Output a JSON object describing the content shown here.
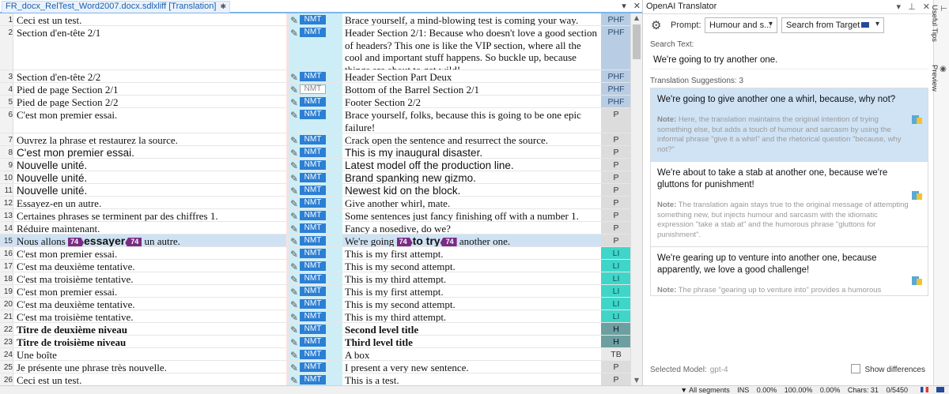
{
  "editor": {
    "tab_title": "FR_docx_RelTest_Word2007.docx.sdlxliff [Translation]",
    "pin": "✱",
    "controls": {
      "dropdown": "▾",
      "close": "✕"
    },
    "status_badge": "NMT",
    "rows": [
      {
        "n": "1",
        "src": "Ceci est un test.",
        "tgt": "Brace yourself, a mind-blowing test is coming your way.",
        "ctx": "PHF"
      },
      {
        "n": "2",
        "src": "Section d'en-tête 2/1",
        "tgt": "Header Section 2/1: Because who doesn't love a good section of headers? This one is like the VIP section, where all the cool and important stuff happens. So buckle up, because things are about to get wild!",
        "ctx": "PHF"
      },
      {
        "n": "3",
        "src": "Section d'en-tête 2/2",
        "tgt_a": "Header Section Part ",
        "tgt_b": "Deux",
        "ctx": "PHF"
      },
      {
        "n": "4",
        "src": "Pied de page Section 2/1",
        "tgt": "Bottom of the Barrel Section 2/1",
        "ctx": "PHF"
      },
      {
        "n": "5",
        "src": "Pied de page Section 2/2",
        "tgt": "Footer Section 2/2",
        "ctx": "PHF"
      },
      {
        "n": "6",
        "src": "C'est mon premier essai.",
        "tgt": "Brace yourself, folks, because this is going to be one epic failure!",
        "ctx": "P"
      },
      {
        "n": "7",
        "src": "Ouvrez la phrase et restaurez la source.",
        "tgt": "Crack open the sentence and resurrect the source.",
        "ctx": "P"
      },
      {
        "n": "8",
        "src": "C'est mon premier essai.",
        "tgt": "This is my inaugural disaster.",
        "ctx": "P"
      },
      {
        "n": "9",
        "src": "Nouvelle unité.",
        "tgt": "Latest model off the production line.",
        "ctx": "P"
      },
      {
        "n": "10",
        "src": "Nouvelle unité.",
        "tgt_a": "Brand spanking new ",
        "tgt_b": "gizmo",
        "tgt_c": ".",
        "ctx": "P"
      },
      {
        "n": "11",
        "src": "Nouvelle unité.",
        "tgt": "Newest kid on the block.",
        "ctx": "P"
      },
      {
        "n": "12",
        "src": "Essayez-en un autre.",
        "tgt": "Give another whirl, mate.",
        "ctx": "P"
      },
      {
        "n": "13",
        "src": "Certaines phrases se terminent par des chiffres 1.",
        "tgt": "Some sentences just fancy finishing off with a number 1.",
        "ctx": "P"
      },
      {
        "n": "14",
        "src": "Réduire maintenant.",
        "tgt": "Fancy a nosedive, do we?",
        "ctx": "P"
      },
      {
        "n": "15",
        "src_a": "Nous allons ",
        "src_b": "essayer",
        "src_c": " un autre.",
        "tag": "74",
        "tgt_a": "We're going ",
        "tgt_b": "to try",
        "tgt_c": " another one.",
        "ctx": "P"
      },
      {
        "n": "16",
        "src": "C'est mon premier essai.",
        "tgt": "This is my first attempt.",
        "ctx": "LI"
      },
      {
        "n": "17",
        "src": "C'est ma deuxième tentative.",
        "tgt": "This is my second attempt.",
        "ctx": "LI"
      },
      {
        "n": "18",
        "src": "C'est ma troisième tentative.",
        "tgt": "This is my third attempt.",
        "ctx": "LI"
      },
      {
        "n": "19",
        "src": "C'est mon premier essai.",
        "tgt": "This is my first attempt.",
        "ctx": "LI"
      },
      {
        "n": "20",
        "src": "C'est ma deuxième tentative.",
        "tgt": "This is my second attempt.",
        "ctx": "LI"
      },
      {
        "n": "21",
        "src": "C'est ma troisième tentative.",
        "tgt": "This is my third attempt.",
        "ctx": "LI"
      },
      {
        "n": "22",
        "src": "Titre de deuxième niveau",
        "tgt": "Second level title",
        "ctx": "H"
      },
      {
        "n": "23",
        "src": "Titre de troisième niveau",
        "tgt": "Third level title",
        "ctx": "H"
      },
      {
        "n": "24",
        "src": "Une boîte",
        "tgt": "A box",
        "ctx": "TB"
      },
      {
        "n": "25",
        "src": "Je présente une phrase très nouvelle.",
        "tgt": "I present a very new sentence.",
        "ctx": "P"
      },
      {
        "n": "26",
        "src": "Ceci est un test.",
        "tgt": "This is a test.",
        "ctx": "P"
      }
    ]
  },
  "panel": {
    "title": "OpenAI Translator",
    "controls": {
      "menu": "▾",
      "pin": "⊥",
      "close": "✕"
    },
    "prompt_label": "Prompt:",
    "prompt_value": "Humour and s...",
    "search_mode": "Search from Target",
    "search_label": "Search Text:",
    "search_text": "We're going to try another one.",
    "suggestions_label": "Translation Suggestions: 3",
    "note_label": "Note:",
    "suggestions": [
      {
        "text": "We're going to give another one a whirl, because, why not?",
        "note": "Here, the translation maintains the original intention of trying something else, but adds a touch of humour and sarcasm by using the informal phrase \"give it a whirl\" and the rhetorical question \"because, why not?\""
      },
      {
        "text": "We're about to take a stab at another one, because we're gluttons for punishment!",
        "note": "The translation again stays true to the original message of attempting something new, but injects humour and sarcasm with the idiomatic expression \"take a stab at\" and the humorous phrase \"gluttons for punishment\"."
      },
      {
        "text": "We're gearing up to venture into another one, because apparently, we love a good challenge!",
        "note": "The phrase \"gearing up to venture into\" provides a humorous exaggeration of the simple idea of trying something else, while the sarcastic remark \"because apparently, we love a good challenge!\" adds a layer of sarcasm to the translation."
      }
    ],
    "model_label": "Selected Model:",
    "model_value": "gpt-4",
    "show_diff_label": "Show differences"
  },
  "side_tabs": [
    "Useful Tips",
    "Preview"
  ],
  "statusbar": {
    "filter": "All segments",
    "mode": "INS",
    "pct1": "0.00%",
    "pct2": "100.00%",
    "pct3": "0.00%",
    "chars": "Chars: 31",
    "segs": "0/5450"
  }
}
